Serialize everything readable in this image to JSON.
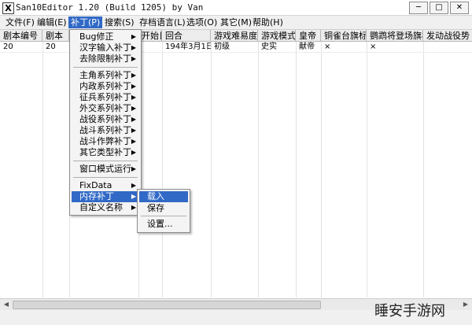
{
  "window": {
    "title": "San10Editor 1.20 (Build 1205) by Van",
    "icon": "X",
    "buttons": [
      "minimize",
      "maximize",
      "close"
    ]
  },
  "menu": [
    {
      "label": "文件(F)"
    },
    {
      "label": "编辑(E)"
    },
    {
      "label": "补丁(P)"
    },
    {
      "label": "搜索(S)"
    },
    {
      "label": "存档语言(L)"
    },
    {
      "label": "选项(O)"
    },
    {
      "label": "其它(M)"
    },
    {
      "label": "帮助(H)"
    }
  ],
  "table": {
    "headers": [
      "剧本编号",
      "剧本",
      "",
      "",
      "开始日",
      "回合",
      "游戏难易度",
      "游戏模式",
      "皇帝",
      "铜雀台旗标",
      "鹦鹉将登场旗标",
      "发动战役势"
    ],
    "row": [
      "20",
      "20",
      "",
      "",
      "",
      "194年3月1日",
      "初级",
      "史实",
      "献帝",
      "×",
      "×",
      ""
    ]
  },
  "patch_menu": {
    "items": [
      {
        "label": "Bug修正",
        "submenu": true
      },
      {
        "label": "汉字输入补丁",
        "submenu": true
      },
      {
        "label": "去除限制补丁",
        "submenu": true
      },
      {
        "label": "主角系列补丁",
        "submenu": true
      },
      {
        "label": "内政系列补丁",
        "submenu": true
      },
      {
        "label": "征兵系列补丁",
        "submenu": true
      },
      {
        "label": "外交系列补丁",
        "submenu": true
      },
      {
        "label": "战役系列补丁",
        "submenu": true
      },
      {
        "label": "战斗系列补丁",
        "submenu": true
      },
      {
        "label": "战斗作弊补丁",
        "submenu": true
      },
      {
        "label": "其它类型补丁",
        "submenu": true
      },
      {
        "label": "窗口模式运行",
        "submenu": true
      },
      {
        "label": "FixData",
        "submenu": true
      },
      {
        "label": "内存补丁",
        "submenu": true
      },
      {
        "label": "自定义名称",
        "submenu": true
      }
    ]
  },
  "memory_submenu": {
    "items": [
      {
        "label": "载入"
      },
      {
        "label": "保存"
      },
      {
        "label": "设置..."
      }
    ]
  },
  "overlay": {
    "text": "睡安手游网"
  },
  "colors": {
    "highlight": "#3169c6",
    "menu_bg": "#f0f0f0"
  }
}
